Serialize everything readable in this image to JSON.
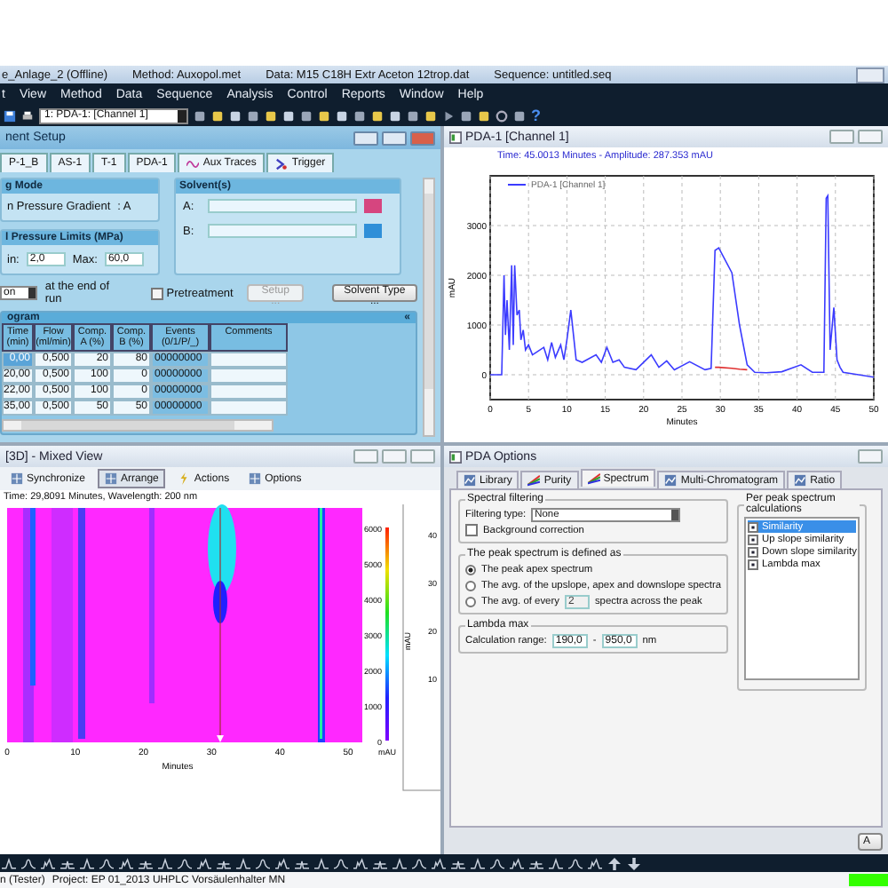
{
  "title_bar": {
    "segments": [
      "e_Anlage_2 (Offline)",
      "Method: Auxopol.met",
      "Data: M15 C18H Extr Aceton 12trop.dat",
      "Sequence: untitled.seq"
    ]
  },
  "menu": [
    "t",
    "View",
    "Method",
    "Data",
    "Sequence",
    "Analysis",
    "Control",
    "Reports",
    "Window",
    "Help"
  ],
  "toolbar": {
    "channel_select": "1: PDA-1: [Channel 1]",
    "help": "?"
  },
  "instrument_setup": {
    "title": "nent Setup",
    "tabs": [
      {
        "label": "P-1_B",
        "selected": false
      },
      {
        "label": "AS-1",
        "selected": false
      },
      {
        "label": "T-1",
        "selected": false
      },
      {
        "label": "PDA-1",
        "selected": false
      },
      {
        "label": "Aux Traces",
        "selected": false
      },
      {
        "label": "Trigger",
        "selected": false
      }
    ],
    "mode": {
      "title": "g Mode",
      "label": "n Pressure Gradient",
      "value": ": A"
    },
    "solvents": {
      "title": "Solvent(s)",
      "items": [
        {
          "label": "A:",
          "color": "#d6457f"
        },
        {
          "label": "B:",
          "color": "#2f8fd8"
        }
      ]
    },
    "pressure": {
      "title": "l Pressure Limits (MPa)",
      "min_label": "in:",
      "min": "2,0",
      "max_label": "Max:",
      "max": "60,0"
    },
    "end_action": {
      "value": "on",
      "label": "at the end of run"
    },
    "pretreatment": {
      "label": "Pretreatment",
      "checked": false
    },
    "setup_button": {
      "label": "Setup ...",
      "disabled": true
    },
    "solvent_type_button": "Solvent Type ...",
    "program": {
      "title": "ogram",
      "collapse": "«",
      "columns": [
        "Time (min)",
        "Flow (ml/min)",
        "Comp. A (%)",
        "Comp. B (%)",
        "Events (0/1/P/_)",
        "Comments"
      ],
      "rows": [
        {
          "cells": [
            "0,00",
            "0,500",
            "20",
            "80",
            "00000000",
            ""
          ],
          "selected": true
        },
        {
          "cells": [
            "20,00",
            "0,500",
            "100",
            "0",
            "00000000",
            ""
          ],
          "selected": false
        },
        {
          "cells": [
            "22,00",
            "0,500",
            "100",
            "0",
            "00000000",
            ""
          ],
          "selected": false
        },
        {
          "cells": [
            "35,00",
            "0,500",
            "50",
            "50",
            "00000000",
            ""
          ],
          "selected": false
        }
      ]
    }
  },
  "chromatogram": {
    "title": "PDA-1 [Channel 1]",
    "readout": "Time: 45.0013 Minutes - Amplitude: 287.353 mAU",
    "chart_data": {
      "type": "line",
      "grid": true,
      "xlabel": "Minutes",
      "ylabel": "mAU",
      "xlim": [
        0,
        50
      ],
      "ylim": [
        -500,
        4000
      ],
      "xticks": [
        0,
        5,
        10,
        15,
        20,
        25,
        30,
        35,
        40,
        45,
        50
      ],
      "yticks": [
        0,
        1000,
        2000,
        3000
      ],
      "x": [
        0,
        1.5,
        1.8,
        2.0,
        2.2,
        2.5,
        2.8,
        3.0,
        3.2,
        3.5,
        3.8,
        4.0,
        4.3,
        4.6,
        5,
        5.5,
        6,
        7,
        7.5,
        8,
        8.5,
        9.2,
        9.6,
        10,
        10.5,
        11.2,
        12,
        13.8,
        14.5,
        15.2,
        16,
        16.8,
        17.5,
        19,
        21,
        22,
        23,
        24,
        26,
        28,
        28.8,
        29.3,
        29.8,
        31.5,
        32.5,
        33.5,
        34.5,
        36,
        38,
        40.5,
        42,
        43.5,
        43.8,
        44,
        44.3,
        44.8,
        45.2,
        45.6,
        46,
        48,
        50
      ],
      "series": [
        {
          "name": "PDA-1 [Channel 1]",
          "color": "#3b3bff",
          "values": [
            0,
            0,
            2000,
            800,
            1500,
            500,
            2200,
            600,
            2200,
            1200,
            1300,
            700,
            900,
            500,
            600,
            400,
            450,
            550,
            300,
            650,
            350,
            600,
            300,
            700,
            1300,
            300,
            250,
            400,
            250,
            550,
            250,
            300,
            150,
            100,
            400,
            150,
            280,
            100,
            260,
            100,
            130,
            2500,
            2550,
            2050,
            1000,
            200,
            50,
            40,
            60,
            200,
            50,
            50,
            3550,
            3600,
            500,
            1350,
            300,
            150,
            50,
            0,
            -50
          ]
        },
        {
          "color": "#e03030",
          "values": [
            null,
            null,
            null,
            null,
            null,
            null,
            null,
            null,
            null,
            null,
            null,
            null,
            null,
            null,
            null,
            null,
            null,
            null,
            null,
            null,
            null,
            null,
            null,
            null,
            null,
            null,
            null,
            null,
            null,
            null,
            null,
            null,
            null,
            null,
            null,
            null,
            null,
            null,
            null,
            null,
            null,
            150,
            150,
            130,
            110,
            100,
            null,
            null,
            null,
            null,
            null,
            null,
            null,
            null,
            null,
            null,
            null,
            null,
            null,
            null,
            null
          ]
        }
      ]
    }
  },
  "mixed_view": {
    "title": "[3D] - Mixed View",
    "tools": [
      {
        "label": "Synchronize",
        "selected": false
      },
      {
        "label": "Arrange",
        "selected": true
      },
      {
        "label": "Actions",
        "selected": false
      },
      {
        "label": "Options",
        "selected": false
      }
    ],
    "readout": "Time: 29,8091 Minutes, Wavelength: 200 nm",
    "xticks": [
      "0",
      "10",
      "20",
      "30",
      "40",
      "50"
    ],
    "xlabel": "Minutes",
    "scale_ticks": [
      "6000",
      "5000",
      "4000",
      "3000",
      "2000",
      "1000",
      "0"
    ],
    "scale_unit": "mAU",
    "spectrum_ticks": [
      "40",
      "30",
      "20",
      "10"
    ],
    "spectrum_unit": "mAU"
  },
  "pda_options": {
    "title": "PDA Options",
    "tabs": [
      {
        "label": "Library",
        "selected": false
      },
      {
        "label": "Purity",
        "selected": false
      },
      {
        "label": "Spectrum",
        "selected": true
      },
      {
        "label": "Multi-Chromatogram",
        "selected": false
      },
      {
        "label": "Ratio",
        "selected": false
      }
    ],
    "filtering": {
      "title": "Spectral filtering",
      "type_label": "Filtering type:",
      "type": "None",
      "background": {
        "label": "Background correction",
        "checked": false
      }
    },
    "peak_spectrum": {
      "title": "The peak spectrum is defined as",
      "options": [
        {
          "label": "The peak apex spectrum",
          "selected": true
        },
        {
          "label": "The avg. of the upslope, apex and downslope spectra",
          "selected": false
        },
        {
          "label": "The avg. of every",
          "value": "2",
          "suffix": "spectra across the peak",
          "selected": false
        }
      ]
    },
    "lambda": {
      "title": "Lambda max",
      "label": "Calculation range:",
      "from": "190,0",
      "sep": "-",
      "to": "950,0",
      "unit": "nm"
    },
    "calculations": {
      "title": "Per peak spectrum calculations",
      "items": [
        {
          "label": "Similarity",
          "checked": true,
          "selected": true
        },
        {
          "label": "Up slope similarity",
          "checked": true,
          "selected": false
        },
        {
          "label": "Down slope similarity",
          "checked": true,
          "selected": false
        },
        {
          "label": "Lambda max",
          "checked": true,
          "selected": false
        }
      ]
    },
    "apply": "A"
  },
  "status_bar": {
    "user": "n (Tester)",
    "project": "Project: EP 01_2013 UHPLC Vorsäulenhalter MN"
  }
}
